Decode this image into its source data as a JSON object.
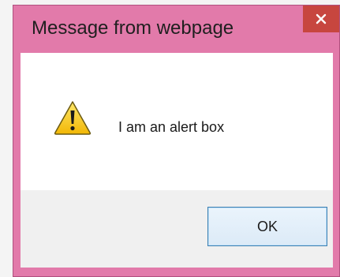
{
  "dialog": {
    "title": "Message from webpage",
    "close_icon": "close-icon",
    "message_icon": "warning-icon",
    "message": "I am an alert box",
    "ok_label": "OK"
  },
  "colors": {
    "frame": "#e27aaa",
    "close_button": "#c7463f",
    "button_area": "#f0f0f0",
    "ok_border": "#3c7fb1"
  }
}
